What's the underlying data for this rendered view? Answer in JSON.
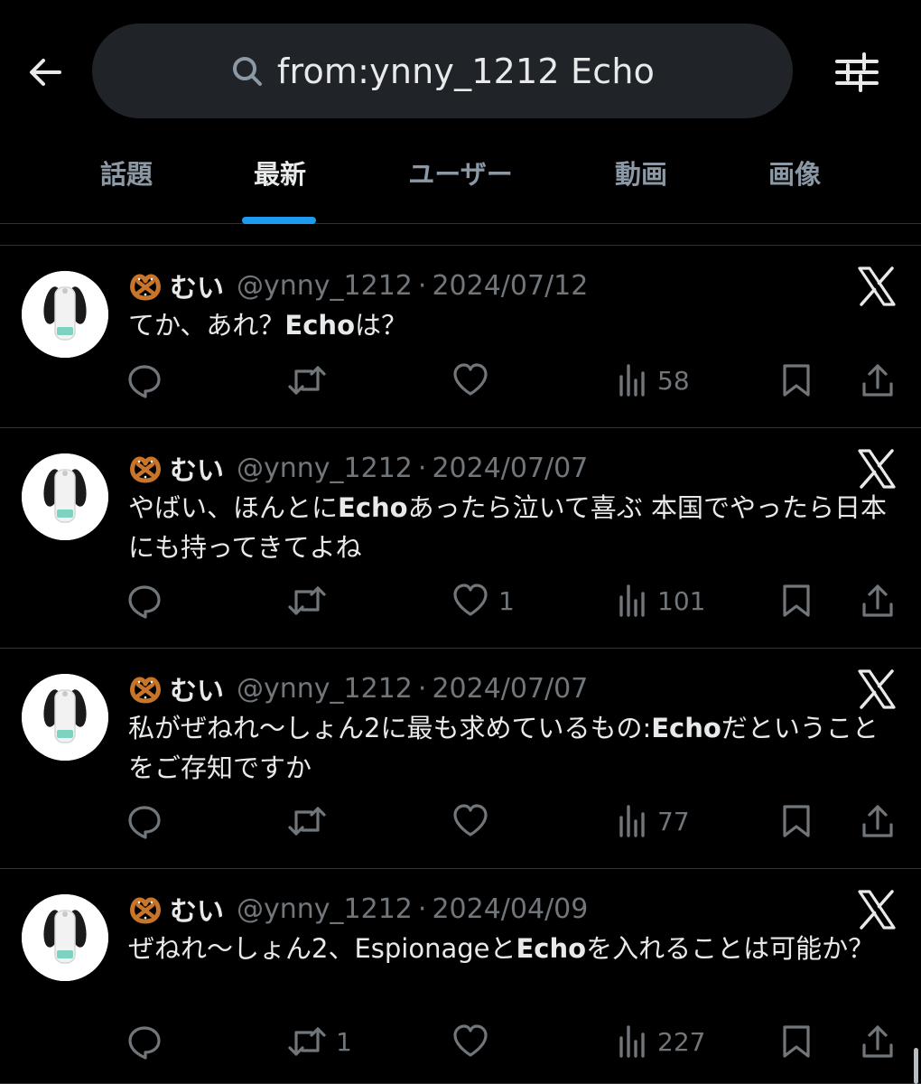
{
  "search": {
    "query": "from:ynny_1212 Echo"
  },
  "tabs": [
    {
      "label": "話題"
    },
    {
      "label": "最新"
    },
    {
      "label": "ユーザー"
    },
    {
      "label": "動画"
    },
    {
      "label": "画像"
    }
  ],
  "active_tab": "最新",
  "colors": {
    "background": "#000000",
    "accent": "#1d9bf0",
    "muted": "#71767b",
    "text": "#e7e9ea"
  },
  "icons": [
    "back-arrow-icon",
    "search-icon",
    "filter-sliders-icon",
    "pretzel-icon",
    "x-logo-icon",
    "reply-icon",
    "retweet-icon",
    "like-icon",
    "views-icon",
    "bookmark-icon",
    "share-icon"
  ],
  "tweets": [
    {
      "name": "むい",
      "handle": "@ynny_1212",
      "sep": "·",
      "date": "2024/07/12",
      "body": [
        {
          "t": "てか、あれ？"
        },
        {
          "t": "Echo",
          "b": true
        },
        {
          "t": "は？"
        }
      ],
      "replies": "",
      "retweets": "",
      "likes": "",
      "views": "58"
    },
    {
      "name": "むい",
      "handle": "@ynny_1212",
      "sep": "·",
      "date": "2024/07/07",
      "body": [
        {
          "t": "やばい、ほんとに"
        },
        {
          "t": "Echo",
          "b": true
        },
        {
          "t": "あったら泣いて喜ぶ  本国でやったら日本にも持ってきてよね"
        }
      ],
      "replies": "",
      "retweets": "",
      "likes": "1",
      "views": "101"
    },
    {
      "name": "むい",
      "handle": "@ynny_1212",
      "sep": "·",
      "date": "2024/07/07",
      "body": [
        {
          "t": "私がぜねれ〜しょん2に最も求めているもの:"
        },
        {
          "t": "Echo",
          "b": true
        },
        {
          "t": "だということをご存知ですか"
        }
      ],
      "replies": "",
      "retweets": "",
      "likes": "",
      "views": "77"
    },
    {
      "name": "むい",
      "handle": "@ynny_1212",
      "sep": "·",
      "date": "2024/04/09",
      "body": [
        {
          "t": "ぜねれ〜しょん2、Espionageと"
        },
        {
          "t": "Echo",
          "b": true
        },
        {
          "t": "を入れることは可能か？"
        }
      ],
      "replies": "",
      "retweets": "1",
      "likes": "",
      "views": "227"
    }
  ]
}
